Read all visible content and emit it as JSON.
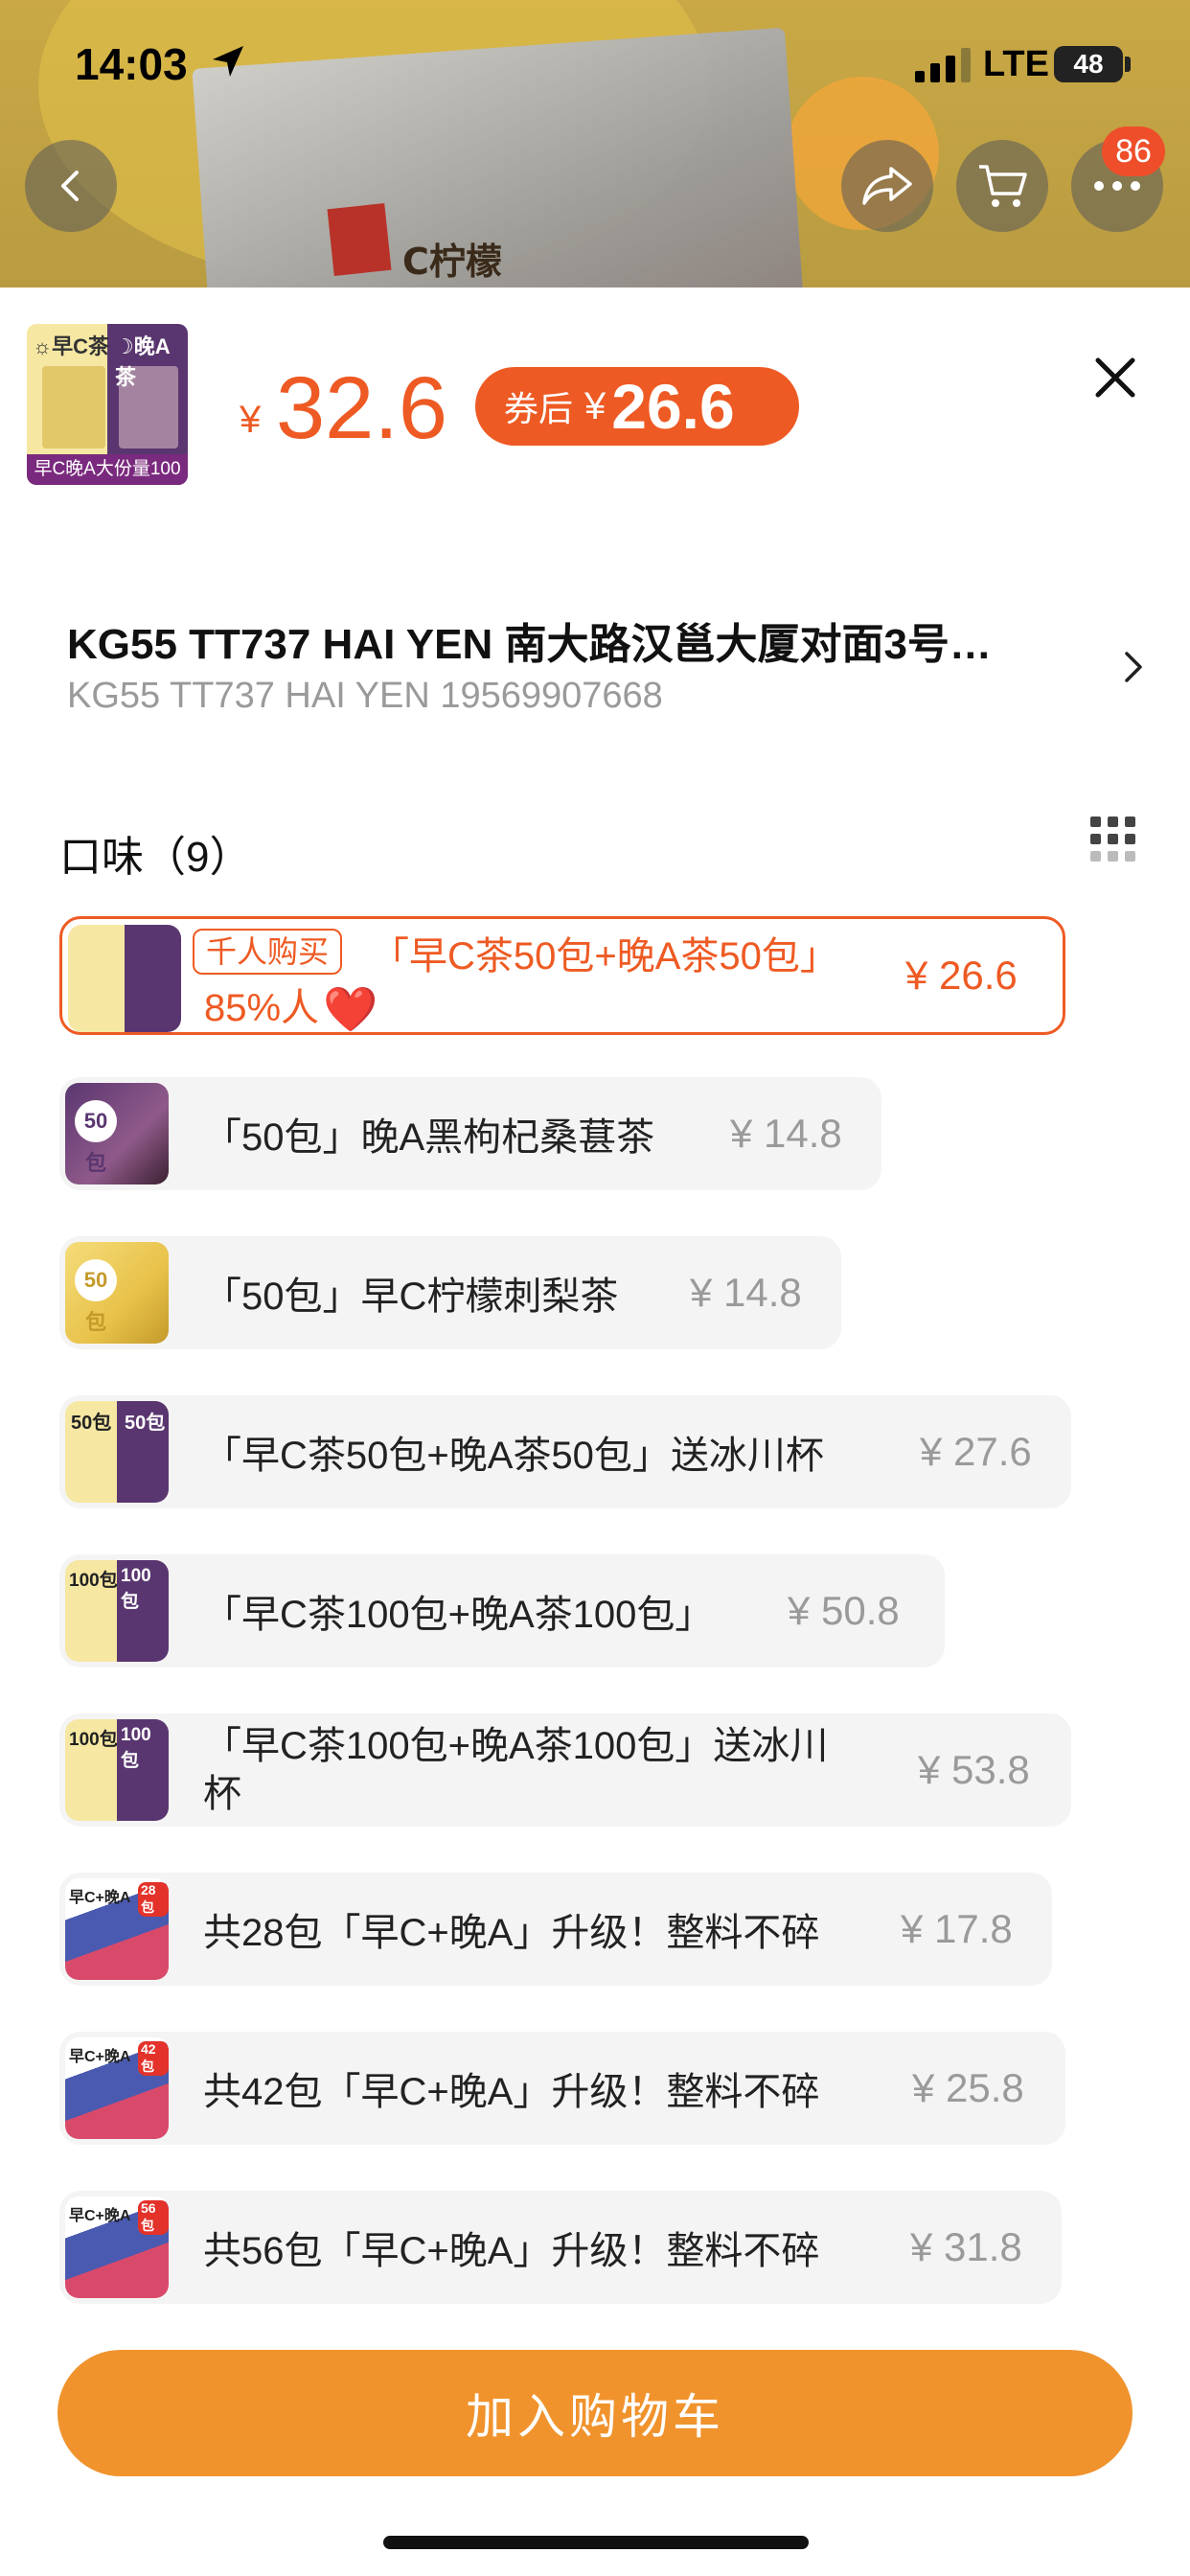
{
  "status_bar": {
    "time": "14:03",
    "network": "LTE",
    "battery": "48"
  },
  "header": {
    "cart_badge": "86",
    "background_label": "C柠檬"
  },
  "product": {
    "thumb_labels": [
      "☼早C茶",
      "☽晚A茶",
      "早C晚A大份量100包"
    ],
    "currency": "¥",
    "price": "32.6",
    "coupon_label": "券后",
    "coupon_currency": "¥",
    "coupon_price": "26.6"
  },
  "address": {
    "title": "KG55 TT737 HAI YEN 南大路汉邕大厦对面3号…",
    "subtitle": "KG55 TT737 HAI YEN 19569907668"
  },
  "section": {
    "title": "口味（9）"
  },
  "selected_option": {
    "tag": "千人购买",
    "name": "「早C茶50包+晚A茶50包」",
    "percent": "85%人",
    "heart": "❤️",
    "price": "¥ 26.6"
  },
  "options": [
    {
      "name": "「50包」晚A黑枸杞桑葚茶",
      "price": "¥ 14.8"
    },
    {
      "name": "「50包」早C柠檬刺梨茶",
      "price": "¥ 14.8"
    },
    {
      "name": "「早C茶50包+晚A茶50包」送冰川杯",
      "price": "¥ 27.6"
    },
    {
      "name": "「早C茶100包+晚A茶100包」",
      "price": "¥ 50.8"
    },
    {
      "name_line1": "「早C茶100包+晚A茶100包」送冰川",
      "name_line2": "杯",
      "price": "¥ 53.8"
    },
    {
      "name": "共28包「早C+晚A」升级！整料不碎",
      "price": "¥ 17.8"
    },
    {
      "name": "共42包「早C+晚A」升级！整料不碎",
      "price": "¥ 25.8"
    },
    {
      "name": "共56包「早C+晚A」升级！整料不碎",
      "price": "¥ 31.8"
    }
  ],
  "thumb_texts": [
    "50包",
    "50包",
    "50包",
    "50包",
    "100包",
    "100包",
    "100包",
    "100包",
    "早C+晚A",
    "28包",
    "早C+晚A",
    "42包",
    "早C+晚A",
    "56包"
  ],
  "cta": {
    "label": "加入购物车"
  },
  "colors": {
    "accent": "#ee5a23",
    "cta": "#f0932d",
    "badge": "#ee4e2a"
  }
}
